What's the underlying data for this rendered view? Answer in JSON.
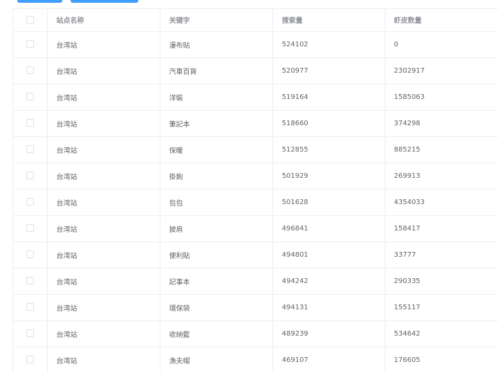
{
  "table": {
    "headers": [
      "站点名称",
      "关键字",
      "搜索量",
      "虾皮数量"
    ],
    "rows": [
      {
        "site": "台湾站",
        "keyword": "瀑布贴",
        "search": "524102",
        "count": "0"
      },
      {
        "site": "台湾站",
        "keyword": "汽車百貨",
        "search": "520977",
        "count": "2302917"
      },
      {
        "site": "台湾站",
        "keyword": "洋裝",
        "search": "519164",
        "count": "1585063"
      },
      {
        "site": "台湾站",
        "keyword": "筆記本",
        "search": "518660",
        "count": "374298"
      },
      {
        "site": "台湾站",
        "keyword": "保暖",
        "search": "512855",
        "count": "885215"
      },
      {
        "site": "台湾站",
        "keyword": "掛鉤",
        "search": "501929",
        "count": "269913"
      },
      {
        "site": "台湾站",
        "keyword": "包包",
        "search": "501628",
        "count": "4354033"
      },
      {
        "site": "台湾站",
        "keyword": "披肩",
        "search": "496841",
        "count": "158417"
      },
      {
        "site": "台湾站",
        "keyword": "便利貼",
        "search": "494801",
        "count": "33777"
      },
      {
        "site": "台湾站",
        "keyword": "記事本",
        "search": "494242",
        "count": "290335"
      },
      {
        "site": "台湾站",
        "keyword": "環保袋",
        "search": "494131",
        "count": "155117"
      },
      {
        "site": "台湾站",
        "keyword": "收納籃",
        "search": "489239",
        "count": "534642"
      },
      {
        "site": "台湾站",
        "keyword": "漁夫帽",
        "search": "469107",
        "count": "176605"
      }
    ]
  },
  "colors": {
    "primary": "#409eff",
    "border": "#ebeef5",
    "header_text": "#909399",
    "cell_text": "#606266"
  }
}
